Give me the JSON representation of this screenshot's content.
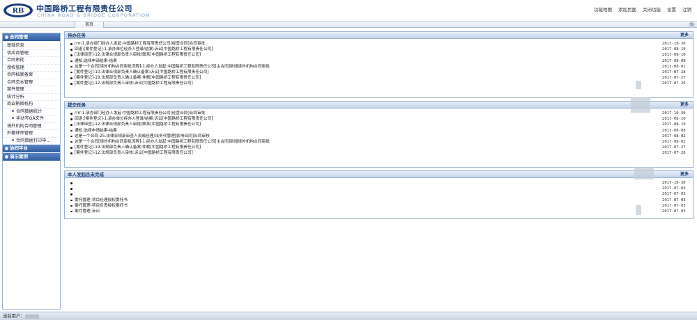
{
  "header": {
    "logo_text": "RB",
    "company_cn": "中国路桥工程有限责任公司",
    "company_en": "CHINA ROAD & BRIDGE CORPORATION",
    "links": [
      "功能地图",
      "添加页面",
      "关闭功能",
      "设置",
      "注销"
    ]
  },
  "tabbar": {
    "home_tab": "首页"
  },
  "sidebar": {
    "section1": "合同管理",
    "items": [
      {
        "label": "基础信息",
        "sub": false
      },
      {
        "label": "供应商管理",
        "sub": false
      },
      {
        "label": "合同审批",
        "sub": false
      },
      {
        "label": "授权管理",
        "sub": false
      },
      {
        "label": "合同档案备案",
        "sub": false
      },
      {
        "label": "合同范本管理",
        "sub": false
      },
      {
        "label": "案件管理",
        "sub": false
      },
      {
        "label": "统计分析",
        "sub": false
      },
      {
        "label": "商业贿赂机构",
        "sub": false
      },
      {
        "label": "合同数据统计",
        "sub": true
      },
      {
        "label": "手动写OA文件",
        "sub": true
      },
      {
        "label": "境外机构合同管理",
        "sub": false
      },
      {
        "label": "外籍律师管理",
        "sub": false
      },
      {
        "label": "合同数据打印申...",
        "sub": true
      }
    ],
    "section2": "协同平台",
    "section3": "演示案例"
  },
  "panels": [
    {
      "title": "待办任务",
      "more": "更多",
      "rows": [
        {
          "text": "rrrr-1.承办部门经办人发起:中国路桥工程有限责任公司[经营合同]合同审批",
          "date": "2017-10-30"
        },
        {
          "text": "回退:[案件登记]-1.承办单位经办人登录/结案:诉讼[中国路桥工程有限责任公司]",
          "date": "2017-08-10"
        },
        {
          "text": "[法律审查]-12.法律合规部负责人审批/联系[中国路桥工程有限责任公司]",
          "date": "2017-08-10"
        },
        {
          "text": "通知:选择申请结果-结果",
          "date": "2017-08-08"
        },
        {
          "text": "这是一个合同[境外机构合同审批流程]-1.经办人发起:中国路桥工程有限责任公司[主合同]新增境外机构合同审批",
          "date": "2017-08-02"
        },
        {
          "text": "[案件登记]-10.法律合规部负责人确认备案:诉讼[中国路桥工程有限责任公司]",
          "date": "2017-07-28"
        },
        {
          "text": "[案件登记]-19.法规部负责人确认备案:仲裁[中国路桥工程有限责任公司]",
          "date": "2017-07-27"
        },
        {
          "text": "[案件登记]-12.法规部负责人审核:诉讼[中国路桥工程有限责任公司]",
          "date": "2017-07-26"
        }
      ]
    },
    {
      "title": "提交任务",
      "more": "更多",
      "rows": [
        {
          "text": "rrrr-1.承办部门经办人发起:中国路桥工程有限责任公司[经营合同]合同审批",
          "date": "2017-10-30"
        },
        {
          "text": "回退:[案件登记]-1.承办单位经办人登录/结案:诉讼[中国路桥工程有限责任公司]",
          "date": "2017-08-10"
        },
        {
          "text": "[法律审查]-12.法律合规部负责人审批/联系[中国路桥工程有限责任公司]",
          "date": "2017-08-10"
        },
        {
          "text": "通知:选择申请结果-结果",
          "date": "2017-08-08"
        },
        {
          "text": "这是一个合同-25.法律合规部审查人员或经理/法务代管理[影响合同]合同审核",
          "date": "2017-08-02"
        },
        {
          "text": "这是一个合同[境外机构合同审批流程]-1.经办人发起:中国路桥工程有限责任公司[主合同]新增境外机构合同审批",
          "date": "2017-08-02"
        },
        {
          "text": "[案件登记]-19.法规部负责人确认备案:仲裁[中国路桥工程有限责任公司]",
          "date": "2017-07-27"
        },
        {
          "text": "[案件登记]-12.法规部负责人审核:诉讼[中国路桥工程有限责任公司]",
          "date": "2017-07-26"
        }
      ]
    },
    {
      "title": "本人发起且未完成",
      "more": "更多",
      "rows": [
        {
          "text": "",
          "date": "2017-10-30"
        },
        {
          "text": "",
          "date": "2017-07-03"
        },
        {
          "text": "",
          "date": "2017-07-03"
        },
        {
          "text": "委托管理-项目经理授权委托书",
          "date": "2017-07-03"
        },
        {
          "text": "委托管理-项目负责授权委托书",
          "date": "2017-07-03"
        },
        {
          "text": "案件管理-诉讼",
          "date": "2017-07-03"
        }
      ]
    }
  ],
  "statusbar": {
    "label": "当前用户："
  }
}
